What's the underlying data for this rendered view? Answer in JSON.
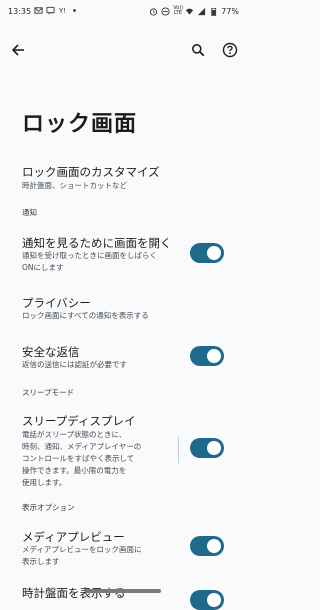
{
  "status_bar": {
    "time": "13:35",
    "network": "Vo)) LTE",
    "battery": "77%"
  },
  "toolbar": {
    "back_icon": "arrow-left-icon",
    "search_icon": "search-icon",
    "help_icon": "help-circle-icon"
  },
  "page": {
    "title": "ロック画面"
  },
  "items": {
    "customize": {
      "title": "ロック画面のカスタマイズ",
      "subtitle": "時計盤面、ショートカットなど"
    },
    "section_notifications": "通知",
    "wake_screen": {
      "title": "通知を見るために画面を開く",
      "subtitle_1": "通知を受け取ったときに画面をしばらく",
      "subtitle_2": "ONにします",
      "enabled": true
    },
    "privacy": {
      "title": "プライバシー",
      "subtitle": "ロック画面にすべての通知を表示する"
    },
    "safe_reply": {
      "title": "安全な返信",
      "subtitle": "返信の送信には認証が必要です",
      "enabled": true
    },
    "section_sleep": "スリープモード",
    "sleep_display": {
      "title": "スリープディスプレイ",
      "subtitle_1": "電話がスリープ状態のときに、",
      "subtitle_2": "時刻、通知、メディアプレイヤーの",
      "subtitle_3": "コントロールをすばやく表示して",
      "subtitle_4": "操作できます。最小限の電力を",
      "subtitle_5": "使用します。",
      "enabled": true
    },
    "section_display": "表示オプション",
    "media_preview": {
      "title": "メディアプレビュー",
      "subtitle_1": "メディアプレビューをロック画面に",
      "subtitle_2": "表示します",
      "enabled": true
    },
    "show_clock": {
      "title": "時計盤面を表示する",
      "enabled": true
    }
  },
  "colors": {
    "toggle_on": "#1f6a8c",
    "background": "#f9fafb"
  }
}
